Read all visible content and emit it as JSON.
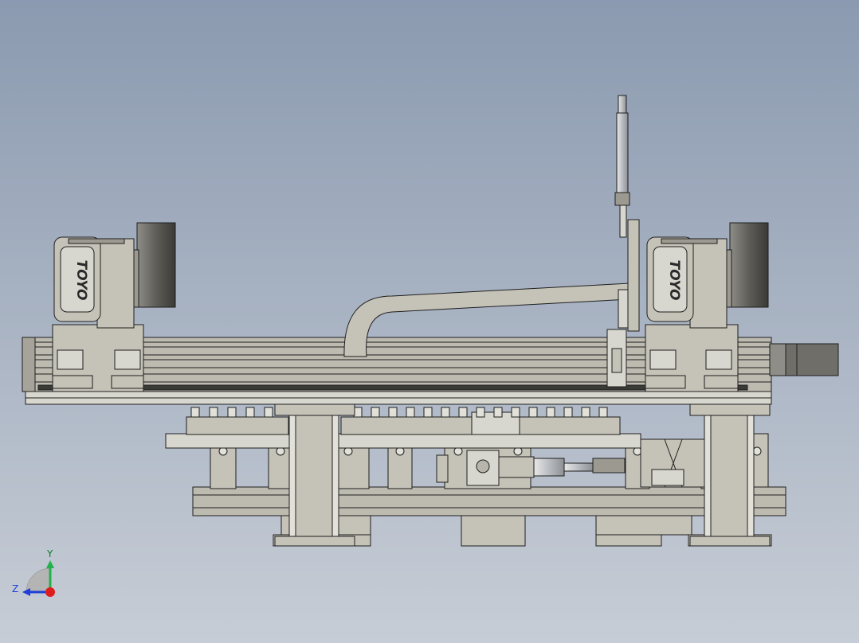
{
  "viewport": {
    "background_top": "#8b9ab0",
    "background_bottom": "#c7cdd6",
    "part_fill": "#c5c3b8",
    "part_fill_light": "#d8d7cf",
    "part_fill_dark": "#9c9a90",
    "edge_color": "#1e1e1e"
  },
  "motor_branding": {
    "left_motor_logo": "TOYO",
    "right_motor_logo": "TOYO"
  },
  "triad": {
    "y_label": "Y",
    "z_label": "Z",
    "y_color": "#22b14c",
    "z_color": "#1f3fd6",
    "x_color": "#e01b1b"
  }
}
